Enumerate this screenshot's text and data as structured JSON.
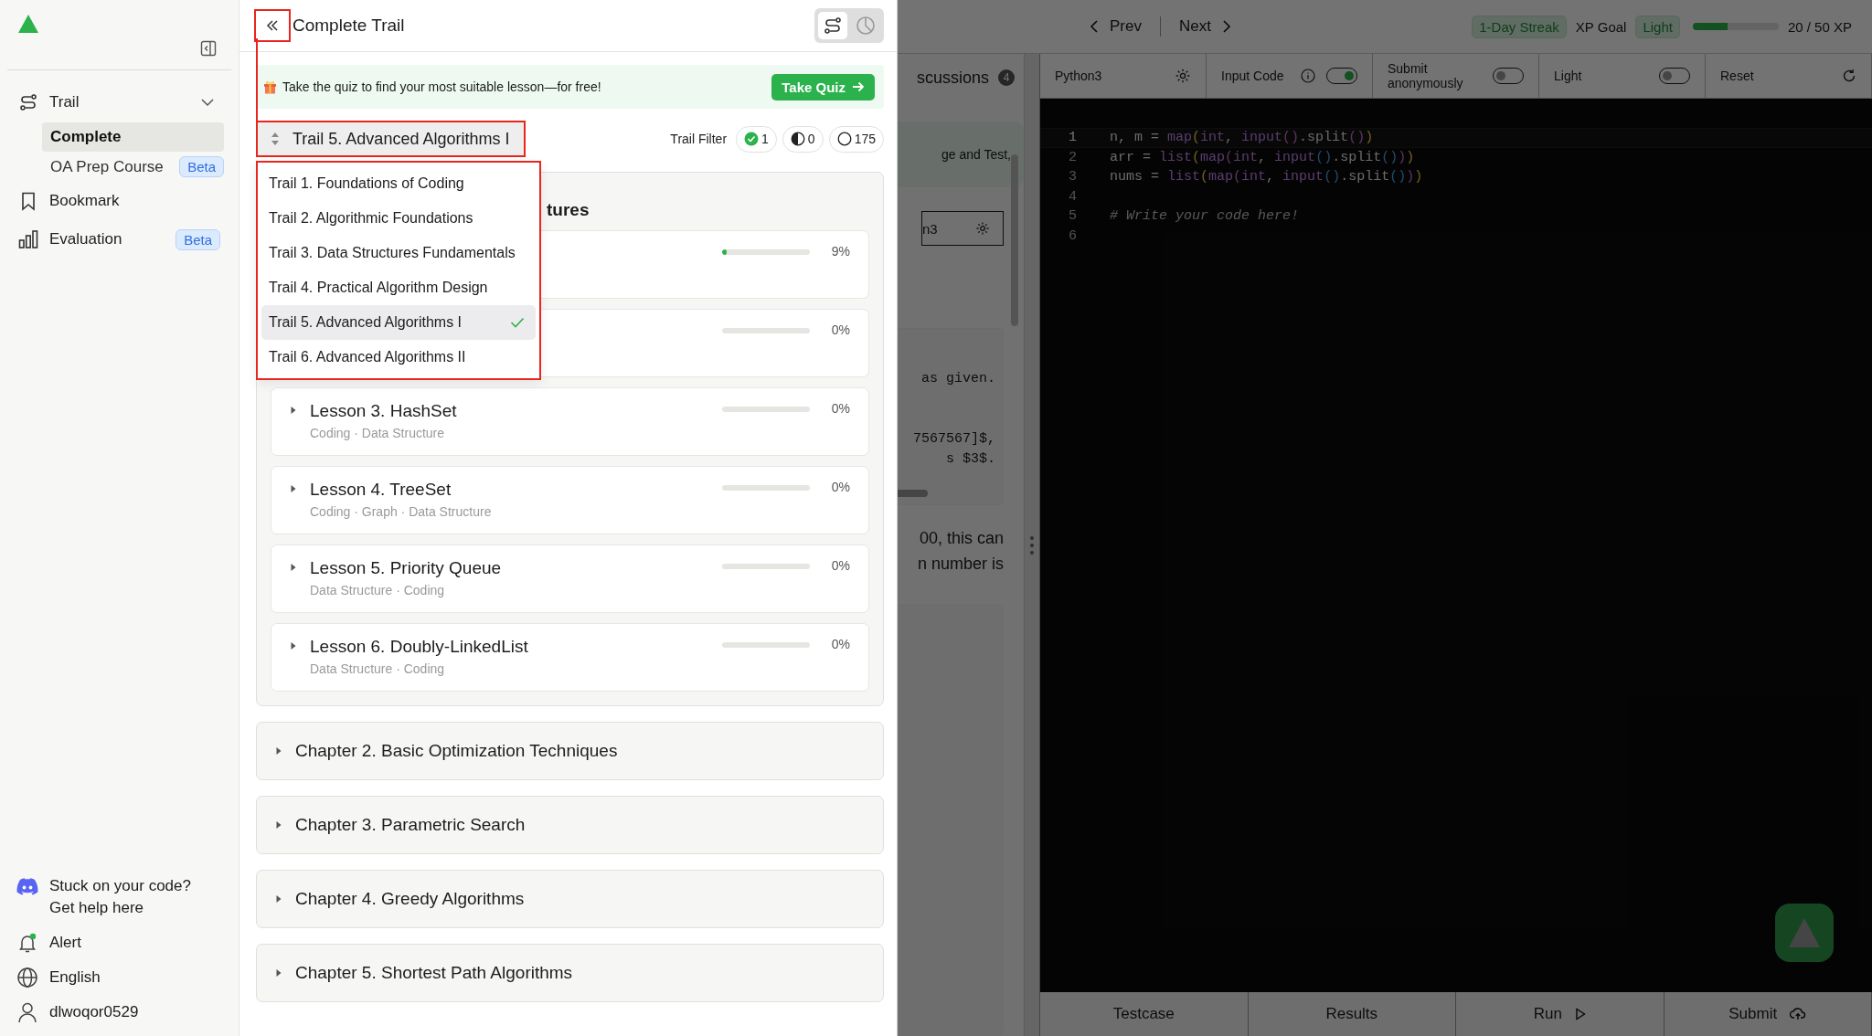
{
  "sidebar": {
    "nav": [
      {
        "kind": "trail",
        "label": "Trail",
        "expanded": true,
        "children": [
          {
            "label": "Complete",
            "selected": true
          },
          {
            "label": "OA Prep Course",
            "selected": false,
            "badge": "Beta"
          }
        ]
      },
      {
        "kind": "bookmark",
        "label": "Bookmark"
      },
      {
        "kind": "evaluation",
        "label": "Evaluation",
        "badge": "Beta"
      }
    ],
    "help_text": [
      "Stuck on your code?",
      "Get help here"
    ],
    "footer": [
      {
        "kind": "alert",
        "label": "Alert",
        "unread": true
      },
      {
        "kind": "language",
        "label": "English"
      },
      {
        "kind": "user",
        "label": "dlwoqor0529"
      }
    ]
  },
  "trail_panel": {
    "title": "Complete Trail",
    "back_highlighted": true,
    "view_toggle": [
      {
        "kind": "trail",
        "selected": true
      },
      {
        "kind": "stats",
        "selected": false
      }
    ],
    "quiz_banner": {
      "text": "Take the quiz to find your most suitable lesson—for free!",
      "button": "Take Quiz"
    },
    "trail_selector": {
      "value": "Trail 5. Advanced Algorithms I",
      "highlighted": true
    },
    "trail_filter": {
      "label": "Trail Filter",
      "counts": [
        {
          "kind": "done",
          "count": "1"
        },
        {
          "kind": "partial",
          "count": "0"
        },
        {
          "kind": "todo",
          "count": "175"
        }
      ]
    },
    "trail_menu": {
      "highlighted": true,
      "items": [
        {
          "label": "Trail 1. Foundations of Coding",
          "selected": false
        },
        {
          "label": "Trail 2. Algorithmic Foundations",
          "selected": false
        },
        {
          "label": "Trail 3. Data Structures Fundamentals",
          "selected": false
        },
        {
          "label": "Trail 4. Practical Algorithm Design",
          "selected": false
        },
        {
          "label": "Trail 5. Advanced Algorithms I",
          "selected": true
        },
        {
          "label": "Trail 6. Advanced Algorithms II",
          "selected": false
        }
      ]
    },
    "chapters": [
      {
        "title": "tures",
        "expanded": true,
        "lessons": [
          {
            "level": 0.05,
            "progress": "9%"
          },
          {
            "level": 0,
            "progress": "0%"
          },
          {
            "title": "Lesson 3. HashSet",
            "tags": "Coding · Data Structure",
            "level": 0,
            "progress": "0%"
          },
          {
            "title": "Lesson 4. TreeSet",
            "tags": "Coding · Graph · Data Structure",
            "level": 0,
            "progress": "0%"
          },
          {
            "title": "Lesson 5. Priority Queue",
            "tags": "Data Structure · Coding",
            "level": 0,
            "progress": "0%"
          },
          {
            "title": "Lesson 6. Doubly-LinkedList",
            "tags": "Data Structure · Coding",
            "level": 0,
            "progress": "0%"
          }
        ]
      },
      {
        "title": "Chapter 2. Basic Optimization Techniques",
        "expanded": false
      },
      {
        "title": "Chapter 3. Parametric Search",
        "expanded": false
      },
      {
        "title": "Chapter 4. Greedy Algorithms",
        "expanded": false
      },
      {
        "title": "Chapter 5. Shortest Path Algorithms",
        "expanded": false
      }
    ]
  },
  "workspace": {
    "dimmed": true,
    "nav": {
      "prev": "Prev",
      "next": "Next"
    },
    "streak": "1-Day Streak",
    "xp_goal_label": "XP Goal",
    "xp_goal_badge": "Light",
    "xp": {
      "level": 0.4,
      "reading": "20 / 50 XP"
    },
    "problem": {
      "tab": "scussions",
      "tab_count": "4",
      "card_text": "ge and Test,",
      "language": "n3",
      "code_groups": [
        [
          "as given."
        ],
        [
          "7567567]$,",
          "s $3$."
        ]
      ],
      "text_lines": [
        "00, this can",
        "n number is"
      ]
    },
    "toolbar": [
      {
        "kind": "select",
        "label": "Python3"
      },
      {
        "kind": "toggle",
        "label": "Input Code",
        "on": true,
        "info": true
      },
      {
        "kind": "toggle",
        "label": "Submit anonymously",
        "on": false
      },
      {
        "kind": "toggle",
        "label": "Light",
        "on": false
      },
      {
        "kind": "reset",
        "label": "Reset"
      }
    ],
    "code": [
      {
        "number": "1",
        "active": true,
        "tokens": [
          {
            "kind": "plain",
            "text": "n, m = "
          },
          {
            "kind": "builtin",
            "text": "map"
          },
          {
            "kind": "bracket1",
            "text": "("
          },
          {
            "kind": "builtin",
            "text": "int"
          },
          {
            "kind": "plain",
            "text": ", "
          },
          {
            "kind": "builtin",
            "text": "input"
          },
          {
            "kind": "bracket2",
            "text": "()"
          },
          {
            "kind": "plain",
            "text": ".split"
          },
          {
            "kind": "bracket2",
            "text": "()"
          },
          {
            "kind": "bracket1",
            "text": ")"
          }
        ]
      },
      {
        "number": "2",
        "active": false,
        "tokens": [
          {
            "kind": "plain",
            "text": "arr = "
          },
          {
            "kind": "builtin",
            "text": "list"
          },
          {
            "kind": "bracket1",
            "text": "("
          },
          {
            "kind": "builtin",
            "text": "map"
          },
          {
            "kind": "bracket2",
            "text": "("
          },
          {
            "kind": "builtin",
            "text": "int"
          },
          {
            "kind": "plain",
            "text": ", "
          },
          {
            "kind": "builtin",
            "text": "input"
          },
          {
            "kind": "bracket3",
            "text": "()"
          },
          {
            "kind": "plain",
            "text": ".split"
          },
          {
            "kind": "bracket3",
            "text": "()"
          },
          {
            "kind": "bracket2",
            "text": ")"
          },
          {
            "kind": "bracket1",
            "text": ")"
          }
        ]
      },
      {
        "number": "3",
        "active": false,
        "tokens": [
          {
            "kind": "plain",
            "text": "nums = "
          },
          {
            "kind": "builtin",
            "text": "list"
          },
          {
            "kind": "bracket1",
            "text": "("
          },
          {
            "kind": "builtin",
            "text": "map"
          },
          {
            "kind": "bracket2",
            "text": "("
          },
          {
            "kind": "builtin",
            "text": "int"
          },
          {
            "kind": "plain",
            "text": ", "
          },
          {
            "kind": "builtin",
            "text": "input"
          },
          {
            "kind": "bracket3",
            "text": "()"
          },
          {
            "kind": "plain",
            "text": ".split"
          },
          {
            "kind": "bracket3",
            "text": "()"
          },
          {
            "kind": "bracket2",
            "text": ")"
          },
          {
            "kind": "bracket1",
            "text": ")"
          }
        ]
      },
      {
        "number": "4",
        "active": false
      },
      {
        "number": "5",
        "active": false,
        "tokens": [
          {
            "kind": "comment",
            "text": "# Write your code here!"
          }
        ]
      },
      {
        "number": "6",
        "active": false
      }
    ],
    "bottom_actions": [
      {
        "kind": "testcase",
        "label": "Testcase"
      },
      {
        "kind": "results",
        "label": "Results"
      },
      {
        "kind": "run",
        "label": "Run"
      },
      {
        "kind": "submit",
        "label": "Submit"
      }
    ]
  }
}
